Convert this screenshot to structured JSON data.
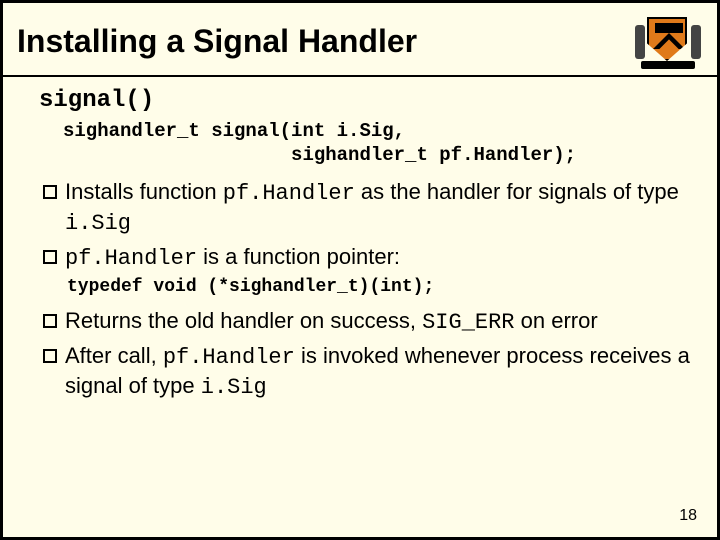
{
  "title": "Installing a Signal Handler",
  "func_name": "signal()",
  "decl_line1": "sighandler_t signal(int i.Sig,",
  "decl_line2": "                    sighandler_t pf.Handler);",
  "bullet1_pre": "Installs function ",
  "bullet1_code1": "pf.Handler",
  "bullet1_mid": " as the handler for signals of type ",
  "bullet1_code2": "i.Sig",
  "bullet2_code": "pf.Handler",
  "bullet2_rest": " is a function pointer:",
  "typedef_line": "typedef void (*sighandler_t)(int);",
  "bullet3_pre": "Returns the old handler on success, ",
  "bullet3_code": "SIG_ERR",
  "bullet3_post": " on error",
  "bullet4_pre": "After call, ",
  "bullet4_code1": "pf.Handler",
  "bullet4_mid": " is invoked whenever process receives a signal of type ",
  "bullet4_code2": "i.Sig",
  "page_number": "18"
}
